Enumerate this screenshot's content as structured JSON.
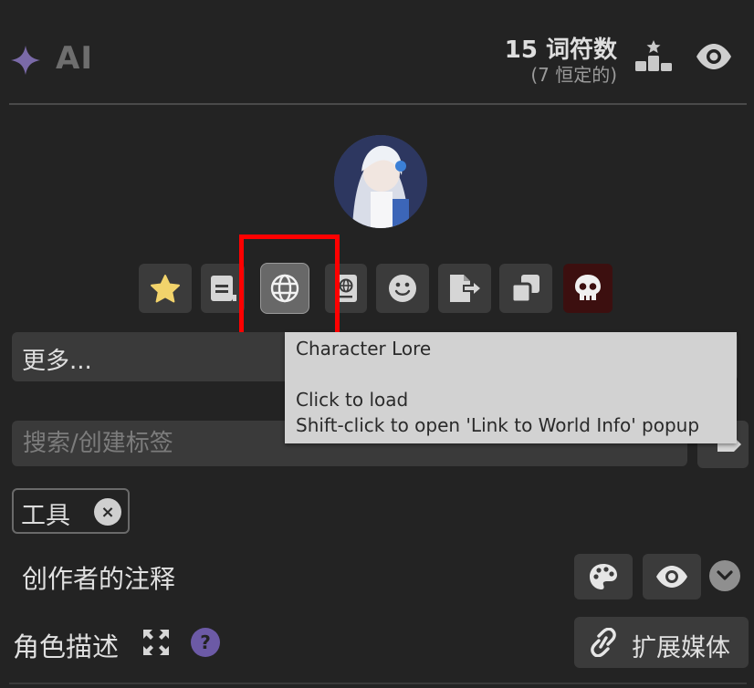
{
  "header": {
    "title": "AI",
    "token_count": "15 词符数",
    "token_permanent": "(7 恒定的)",
    "icons": [
      "sparkle-icon",
      "ranking-icon",
      "eye-icon"
    ]
  },
  "avatar": {
    "alt": "角色头像"
  },
  "toolbar": {
    "buttons": [
      {
        "name": "favorite",
        "icon": "star-icon",
        "color": "#f2d36b"
      },
      {
        "name": "card",
        "icon": "card-icon"
      },
      {
        "name": "character-lore",
        "icon": "globe-icon",
        "active": true
      },
      {
        "name": "passport",
        "icon": "passport-icon"
      },
      {
        "name": "emoji",
        "icon": "smile-icon"
      },
      {
        "name": "export",
        "icon": "export-icon"
      },
      {
        "name": "duplicate",
        "icon": "copy-icon"
      },
      {
        "name": "delete",
        "icon": "skull-icon",
        "color": "#3c0f0f"
      }
    ],
    "highlight_color": "#ff0000"
  },
  "more": {
    "label": "更多..."
  },
  "tooltip": {
    "title": "Character Lore",
    "line1": "Click to load",
    "line2": "Shift-click to open 'Link to World Info' popup"
  },
  "tags": {
    "search_placeholder": "搜索/创建标签",
    "items": [
      {
        "label": "工具",
        "remove": "×"
      }
    ]
  },
  "creator_notes": {
    "label": "创作者的注释"
  },
  "description": {
    "label": "角色描述",
    "help": "?",
    "media_button": "扩展媒体"
  },
  "colors": {
    "background": "#232323",
    "button": "#3b3b3b",
    "help_accent": "#6c5aa6"
  }
}
